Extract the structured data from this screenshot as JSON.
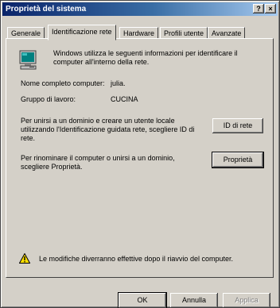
{
  "window": {
    "title": "Proprietà del sistema",
    "help_button": "?",
    "close_button": "×"
  },
  "tabs": [
    {
      "label": "Generale"
    },
    {
      "label": "Identificazione rete"
    },
    {
      "label": "Hardware"
    },
    {
      "label": "Profili utente"
    },
    {
      "label": "Avanzate"
    }
  ],
  "content": {
    "intro_line1": "Windows utilizza le seguenti informazioni per identificare il",
    "intro_line2": "computer all'interno della rete.",
    "computer_name_label": "Nome completo computer:",
    "computer_name_value": "julia.",
    "workgroup_label": "Gruppo di lavoro:",
    "workgroup_value": "CUCINA",
    "domain_text_line1": "Per unirsi a un dominio e creare un utente locale",
    "domain_text_line2": "utilizzando l'Identificazione guidata rete, scegliere ID di",
    "domain_text_line3": "rete.",
    "network_id_button": "ID di rete",
    "rename_text_line1": "Per rinominare il computer o unirsi a un dominio,",
    "rename_text_line2": "scegliere Proprietà.",
    "properties_button": "Proprietà",
    "warning_text": "Le modifiche diverranno effettive dopo il riavvio del computer."
  },
  "footer": {
    "ok_button": "OK",
    "cancel_button": "Annulla",
    "apply_button": "Applica"
  },
  "icons": {
    "computer": "monitor-icon",
    "warning": "warning-icon"
  },
  "colors": {
    "titlebar_start": "#0a246a",
    "titlebar_end": "#a6caf0",
    "dialog_face": "#d4d0c8",
    "warning_yellow": "#ffe000"
  }
}
